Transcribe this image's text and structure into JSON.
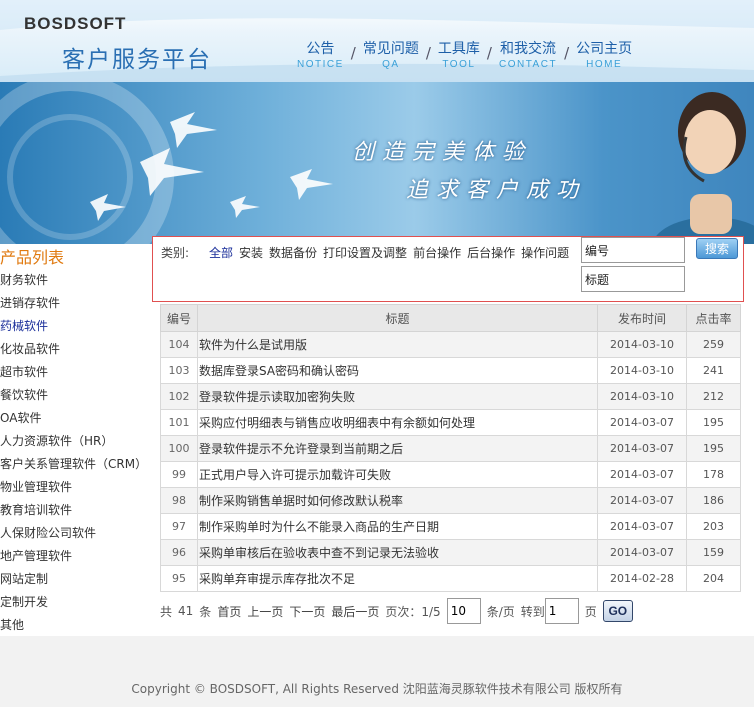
{
  "header": {
    "logo_text": "BOSDSOFT",
    "site_title": "客户服务平台",
    "nav": [
      {
        "cn": "公告",
        "en": "NOTICE"
      },
      {
        "cn": "常见问题",
        "en": "QA"
      },
      {
        "cn": "工具库",
        "en": "TOOL"
      },
      {
        "cn": "和我交流",
        "en": "CONTACT"
      },
      {
        "cn": "公司主页",
        "en": "HOME"
      }
    ],
    "nav_separator": "/"
  },
  "banner": {
    "slogan_1": "创造完美体验",
    "slogan_2": "追求客户成功"
  },
  "sidebar": {
    "title": "产品列表",
    "items": [
      "财务软件",
      "进销存软件",
      "药械软件",
      "化妆品软件",
      "超市软件",
      "餐饮软件",
      "OA软件",
      "人力资源软件（HR）",
      "客户关系管理软件（CRM）",
      "物业管理软件",
      "教育培训软件",
      "人保财险公司软件",
      "地产管理软件",
      "网站定制",
      "定制开发",
      "其他"
    ],
    "active_index": 2
  },
  "filter": {
    "label": "类别:",
    "categories": [
      "全部",
      "安装",
      "数据备份",
      "打印设置及调整",
      "前台操作",
      "后台操作",
      "操作问题"
    ],
    "active_index": 0,
    "field_number_value": "编号",
    "field_title_value": "标题",
    "search_label": "搜索"
  },
  "table": {
    "headers": [
      "编号",
      "标题",
      "发布时间",
      "点击率"
    ],
    "rows": [
      {
        "no": "104",
        "title": "软件为什么是试用版",
        "date": "2014-03-10",
        "hits": "259"
      },
      {
        "no": "103",
        "title": "数据库登录SA密码和确认密码",
        "date": "2014-03-10",
        "hits": "241"
      },
      {
        "no": "102",
        "title": "登录软件提示读取加密狗失败",
        "date": "2014-03-10",
        "hits": "212"
      },
      {
        "no": "101",
        "title": "采购应付明细表与销售应收明细表中有余额如何处理",
        "date": "2014-03-07",
        "hits": "195"
      },
      {
        "no": "100",
        "title": "登录软件提示不允许登录到当前期之后",
        "date": "2014-03-07",
        "hits": "195"
      },
      {
        "no": "99",
        "title": "正式用户导入许可提示加载许可失败",
        "date": "2014-03-07",
        "hits": "178"
      },
      {
        "no": "98",
        "title": "制作采购销售单据时如何修改默认税率",
        "date": "2014-03-07",
        "hits": "186"
      },
      {
        "no": "97",
        "title": "制作采购单时为什么不能录入商品的生产日期",
        "date": "2014-03-07",
        "hits": "203"
      },
      {
        "no": "96",
        "title": "采购单审核后在验收表中查不到记录无法验收",
        "date": "2014-03-07",
        "hits": "159"
      },
      {
        "no": "95",
        "title": "采购单弃审提示库存批次不足",
        "date": "2014-02-28",
        "hits": "204"
      }
    ]
  },
  "pager": {
    "total_prefix": "共",
    "total": "41",
    "total_suffix": "条",
    "first": "首页",
    "prev": "上一页",
    "next": "下一页",
    "last": "最后一页",
    "page_info": "页次：1/5",
    "page_size": "10",
    "page_size_suffix": "条/页",
    "goto_prefix": "转到",
    "goto_value": "1",
    "goto_suffix": "页",
    "go_label": "GO"
  },
  "footer": {
    "copyright": "Copyright © BOSDSOFT, All Rights Reserved 沈阳蓝海灵豚软件技术有限公司 版权所有"
  }
}
